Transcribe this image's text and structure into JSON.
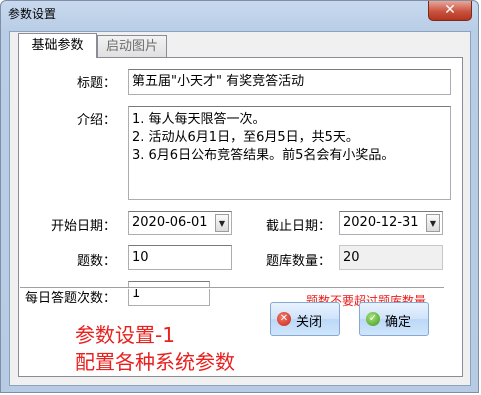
{
  "window": {
    "title": "参数设置",
    "close_glyph": "✕"
  },
  "tabs": [
    {
      "label": "基础参数",
      "active": true
    },
    {
      "label": "启动图片",
      "active": false
    }
  ],
  "form": {
    "title_label": "标题：",
    "title_value": "第五届\"小天才\" 有奖竞答活动",
    "intro_label": "介绍：",
    "intro_lines": [
      "1. 每人每天限答一次。",
      "2. 活动从6月1日，至6月5日，共5天。",
      "3. 6月6日公布竞答结果。前5名会有小奖品。"
    ],
    "start_date_label": "开始日期：",
    "start_date_value": "2020-06-01",
    "end_date_label": "截止日期：",
    "end_date_value": "2020-12-31",
    "question_count_label": "题数：",
    "question_count_value": "10",
    "bank_count_label": "题库数量：",
    "bank_count_value": "20",
    "daily_attempts_label": "每日答题次数：",
    "daily_attempts_value": "1",
    "warning_text": "题数不要超过题库数量"
  },
  "caption": {
    "line1": "参数设置-1",
    "line2": "配置各种系统参数"
  },
  "buttons": {
    "close_label": "关闭",
    "confirm_label": "确定"
  },
  "colors": {
    "accent_red": "#e8201e",
    "button_blue": "#cfe3fa"
  }
}
